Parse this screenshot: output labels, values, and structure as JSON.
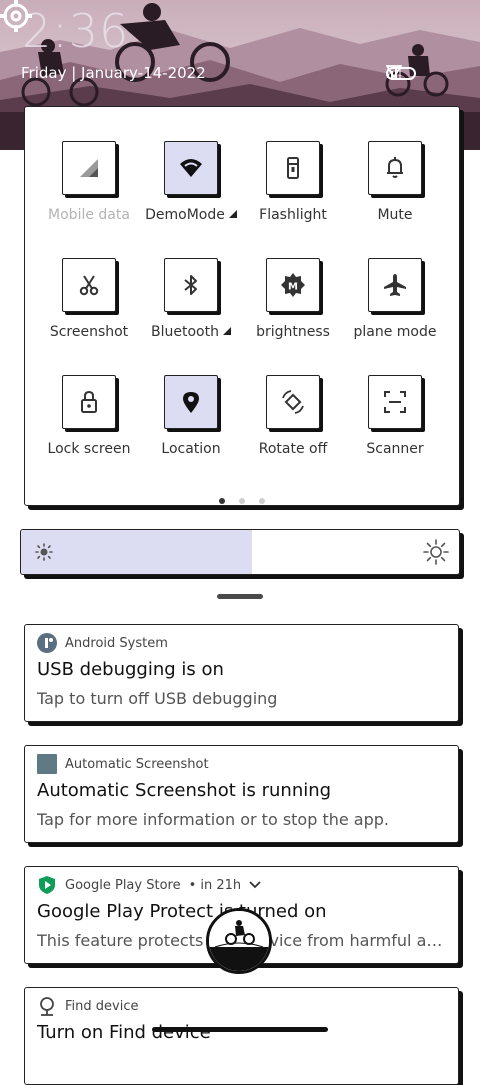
{
  "status": {
    "clock": "2:36",
    "date": "Friday | January-14-2022"
  },
  "quick_settings": {
    "tiles": [
      {
        "label": "Mobile data",
        "icon": "mobile-data-icon",
        "on": false,
        "dim": true,
        "caret": false
      },
      {
        "label": "DemoMode",
        "icon": "wifi-icon",
        "on": true,
        "dim": false,
        "caret": true
      },
      {
        "label": "Flashlight",
        "icon": "flashlight-icon",
        "on": false,
        "dim": false,
        "caret": false
      },
      {
        "label": "Mute",
        "icon": "bell-icon",
        "on": false,
        "dim": false,
        "caret": false
      },
      {
        "label": "Screenshot",
        "icon": "scissors-icon",
        "on": false,
        "dim": false,
        "caret": false
      },
      {
        "label": "Bluetooth",
        "icon": "bluetooth-icon",
        "on": false,
        "dim": false,
        "caret": true
      },
      {
        "label": "brightness",
        "icon": "auto-brightness-icon",
        "on": false,
        "dim": false,
        "caret": false
      },
      {
        "label": "plane mode",
        "icon": "airplane-icon",
        "on": false,
        "dim": false,
        "caret": false
      },
      {
        "label": "Lock screen",
        "icon": "lock-icon",
        "on": false,
        "dim": false,
        "caret": false
      },
      {
        "label": "Location",
        "icon": "location-icon",
        "on": true,
        "dim": false,
        "caret": false
      },
      {
        "label": "Rotate off",
        "icon": "rotate-icon",
        "on": false,
        "dim": false,
        "caret": false
      },
      {
        "label": "Scanner",
        "icon": "scanner-icon",
        "on": false,
        "dim": false,
        "caret": false
      }
    ],
    "page_count": 3,
    "active_page": 1
  },
  "brightness": {
    "level": 0.528,
    "fill_color": "#dcdcf2"
  },
  "notifications": [
    {
      "app": "Android System",
      "time": "",
      "title": "USB debugging is on",
      "body": "Tap to turn off USB debugging",
      "icon": "android-system-icon"
    },
    {
      "app": "Automatic Screenshot",
      "time": "",
      "title": "Automatic Screenshot is running",
      "body": "Tap for more information or to stop the app.",
      "icon": "app-square-icon"
    },
    {
      "app": "Google Play Store",
      "time": "• in 21h",
      "title": "Google Play Protect is turned on",
      "body": "This feature protects your device from harmful ap...",
      "icon": "play-protect-icon"
    },
    {
      "app": "Find device",
      "time": "",
      "title": "Turn on Find device",
      "body": "",
      "icon": "find-device-icon"
    }
  ],
  "colors": {
    "accent": "#dcdcf2",
    "wallpaper_sky": "#d8c4cf",
    "wallpaper_hills": "#5a3c4c"
  }
}
